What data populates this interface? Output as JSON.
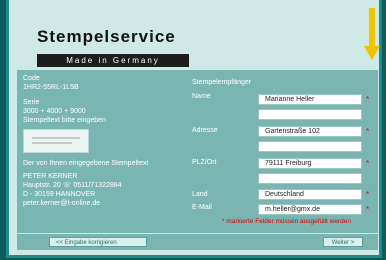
{
  "header": {
    "title": "Stempelservice",
    "subtitle": "Made in Germany"
  },
  "order": {
    "code_label": "Code",
    "code_value": "1HR2-55RL-1L5B",
    "series_label": "Serie",
    "series_value": "3000 + 4000 + 9000",
    "stamp_text_prompt": "Stempeltext bitte eingeben",
    "entered_text_label": "Der von Ihnen eingegebene Stempeltext",
    "address_lines": [
      "PETER KERNER",
      "Hauptstr. 20 ☏ 0511/71322884",
      "D - 30159 HANNOVER",
      "peter.kerner@t-online.de"
    ]
  },
  "recipient": {
    "section_title": "Stempelempfänger",
    "name_label": "Name",
    "name_value": "Marianne Heller",
    "address_label": "Adresse",
    "address_value": "Gartenstraße 102",
    "zip_city_label": "PLZ/Ort",
    "zip_city_value": "79111 Freiburg",
    "country_label": "Land",
    "country_value": "Deutschland",
    "email_label": "E-Mail",
    "email_value": "m.heller@gmx.de",
    "required_note": "* markierte Felder müssen ausgefüllt werden"
  },
  "buttons": {
    "back_label": "<< Eingabe korrigieren",
    "next_label": "Weiter >"
  },
  "colors": {
    "background": "#0f5a5d",
    "panel": "#7bb5b2",
    "accent_arrow": "#f1c400",
    "required_star": "#e00000"
  }
}
